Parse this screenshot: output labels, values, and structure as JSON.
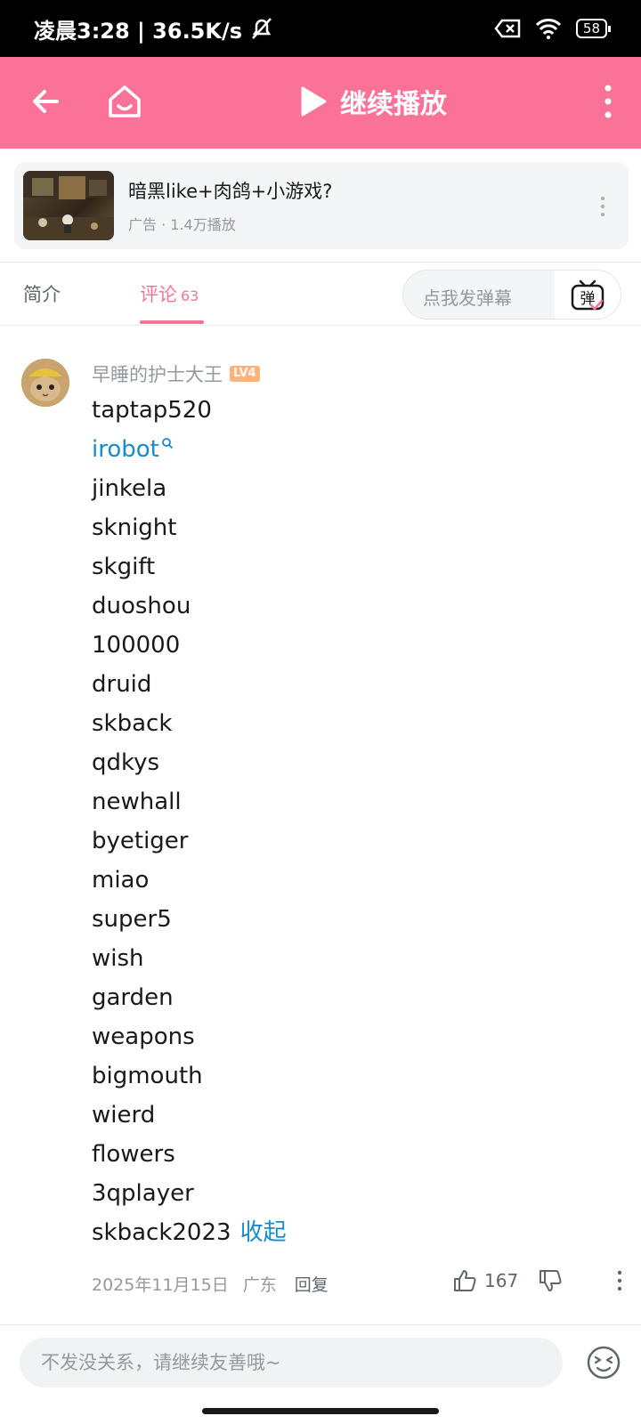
{
  "status": {
    "time": "凌晨3:28 | 36.5K/s",
    "battery": "58"
  },
  "header": {
    "play_label": "继续播放"
  },
  "ad": {
    "title": "暗黑like+肉鸽+小游戏?",
    "subtitle": "广告 · 1.4万播放"
  },
  "tabs": {
    "intro": "简介",
    "comments": "评论",
    "comments_count": "63",
    "danmaku_placeholder": "点我发弹幕"
  },
  "comment": {
    "username": "早睡的护士大王",
    "level": "LV4",
    "lines": [
      "taptap520",
      "irobot",
      "jinkela",
      "sknight",
      "skgift",
      "duoshou",
      "100000",
      "druid",
      "skback",
      "qdkys",
      "newhall",
      "byetiger",
      "miao",
      "super5",
      "wish",
      "garden",
      "weapons",
      "bigmouth",
      "wierd",
      "flowers",
      "3qplayer",
      "skback2023"
    ],
    "collapse": "收起",
    "date": "2025年11月15日",
    "location": "广东",
    "reply": "回复",
    "likes": "167"
  },
  "input": {
    "placeholder": "不发没关系，请继续友善哦~"
  },
  "colors": {
    "accent": "#fb7299",
    "link": "#178bcf"
  }
}
